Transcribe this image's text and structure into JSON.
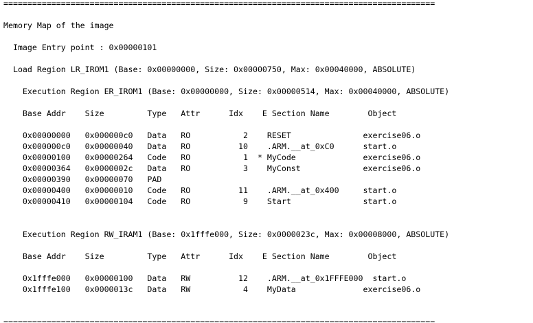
{
  "listing": {
    "separator": "==========================================================================================",
    "lines": [
      "==========================================================================================",
      "",
      "Memory Map of the image",
      "",
      "  Image Entry point : 0x00000101",
      "",
      "  Load Region LR_IROM1 (Base: 0x00000000, Size: 0x00000750, Max: 0x00040000, ABSOLUTE)",
      "",
      "    Execution Region ER_IROM1 (Base: 0x00000000, Size: 0x00000514, Max: 0x00040000, ABSOLUTE)",
      "",
      "    Base Addr    Size         Type   Attr      Idx    E Section Name        Object",
      "",
      "    0x00000000   0x000000c0   Data   RO           2    RESET               exercise06.o",
      "    0x000000c0   0x00000040   Data   RO          10    .ARM.__at_0xC0      start.o",
      "    0x00000100   0x00000264   Code   RO           1  * MyCode              exercise06.o",
      "    0x00000364   0x0000002c   Data   RO           3    MyConst             exercise06.o",
      "    0x00000390   0x00000070   PAD",
      "    0x00000400   0x00000010   Code   RO          11    .ARM.__at_0x400     start.o",
      "    0x00000410   0x00000104   Code   RO           9    Start               start.o",
      "",
      "",
      "    Execution Region RW_IRAM1 (Base: 0x1fffe000, Size: 0x0000023c, Max: 0x00008000, ABSOLUTE)",
      "",
      "    Base Addr    Size         Type   Attr      Idx    E Section Name        Object",
      "",
      "    0x1fffe000   0x00000100   Data   RW          12    .ARM.__at_0x1FFFE000  start.o",
      "    0x1fffe100   0x0000013c   Data   RW           4    MyData              exercise06.o",
      "",
      "",
      "=========================================================================================="
    ]
  }
}
